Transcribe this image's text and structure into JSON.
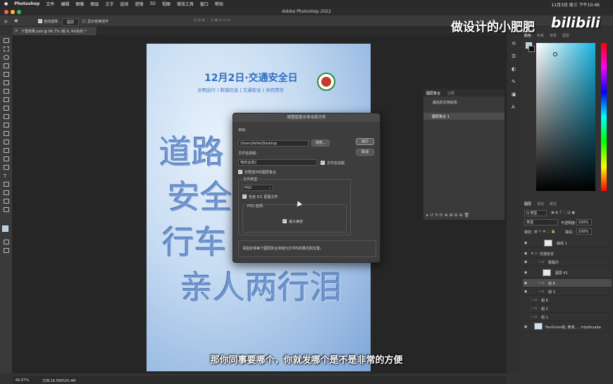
{
  "menubar": {
    "app": "Photoshop",
    "items": [
      "文件",
      "编辑",
      "图像",
      "图层",
      "文字",
      "选择",
      "滤镜",
      "3D",
      "视图",
      "增效工具",
      "窗口",
      "帮助"
    ],
    "clock": "11月3日 周三 下午10:46"
  },
  "window": {
    "title": "Adobe Photoshop 2022"
  },
  "options": {
    "auto_select_label": "自动选择:",
    "auto_select_value": "图层",
    "show_transform": "显示变换控件"
  },
  "document_tab": "下雪效果.psd @ 66.7% (组 6, RGB/8) *",
  "poster": {
    "title": "12月2日·交通安全日",
    "subtitle": "文明出行 | 和谐社会 | 交通安全 | 共同责任",
    "lines": [
      "道路",
      "安全",
      "行车",
      "亲人两行泪"
    ]
  },
  "dialog": {
    "title": "将图层复合导出到文件",
    "dest_label": "目标:",
    "dest_value": "/Users/feifei/Desktop",
    "browse": "浏览...",
    "run": "运行",
    "cancel": "取消",
    "prefix_label": "文件名前缀:",
    "prefix_value": "电商合成2",
    "prefix_check": "文件名前缀",
    "selected_only": "仅限选中的图层复合",
    "filetype_label": "文件类型:",
    "filetype_value": "PSD",
    "icc": "包含 ICC 配置文件",
    "psd_options": "PSD 选项:",
    "max_compat": "最大兼容",
    "hint": "请指定将每个图层复合存储为文件时的格式和位置。"
  },
  "history_panel": {
    "tabs": [
      "图层复合",
      "注释"
    ],
    "row1": "最后的文档状态",
    "row2": "图层复合 1"
  },
  "color_panel": {
    "tabs": [
      "颜色",
      "色板",
      "渐变",
      "图案"
    ]
  },
  "layers_panel": {
    "tabs": [
      "图层",
      "通道",
      "路径"
    ],
    "kind": "Q 类型",
    "mode": "穿透",
    "opacity_label": "不透明度:",
    "opacity": "100%",
    "lock_label": "锁定:",
    "fill_label": "填充:",
    "fill": "100%",
    "layers": [
      "曲线 1",
      "交通安全",
      "胶脂印",
      "图层 41",
      "组 8",
      "组 3",
      "组 6",
      "组 2",
      "组 1",
      "FanGrozo组, 黄滴, ... trtpdxuaba"
    ]
  },
  "status": {
    "zoom": "66.67%",
    "doc": "文档:16.5M/525.4M"
  },
  "overlay": {
    "subtitle": "那你同事要哪个，你就发哪个是不是非常的方便",
    "brand": "做设计的小肥肥",
    "logo": "bilibili"
  }
}
